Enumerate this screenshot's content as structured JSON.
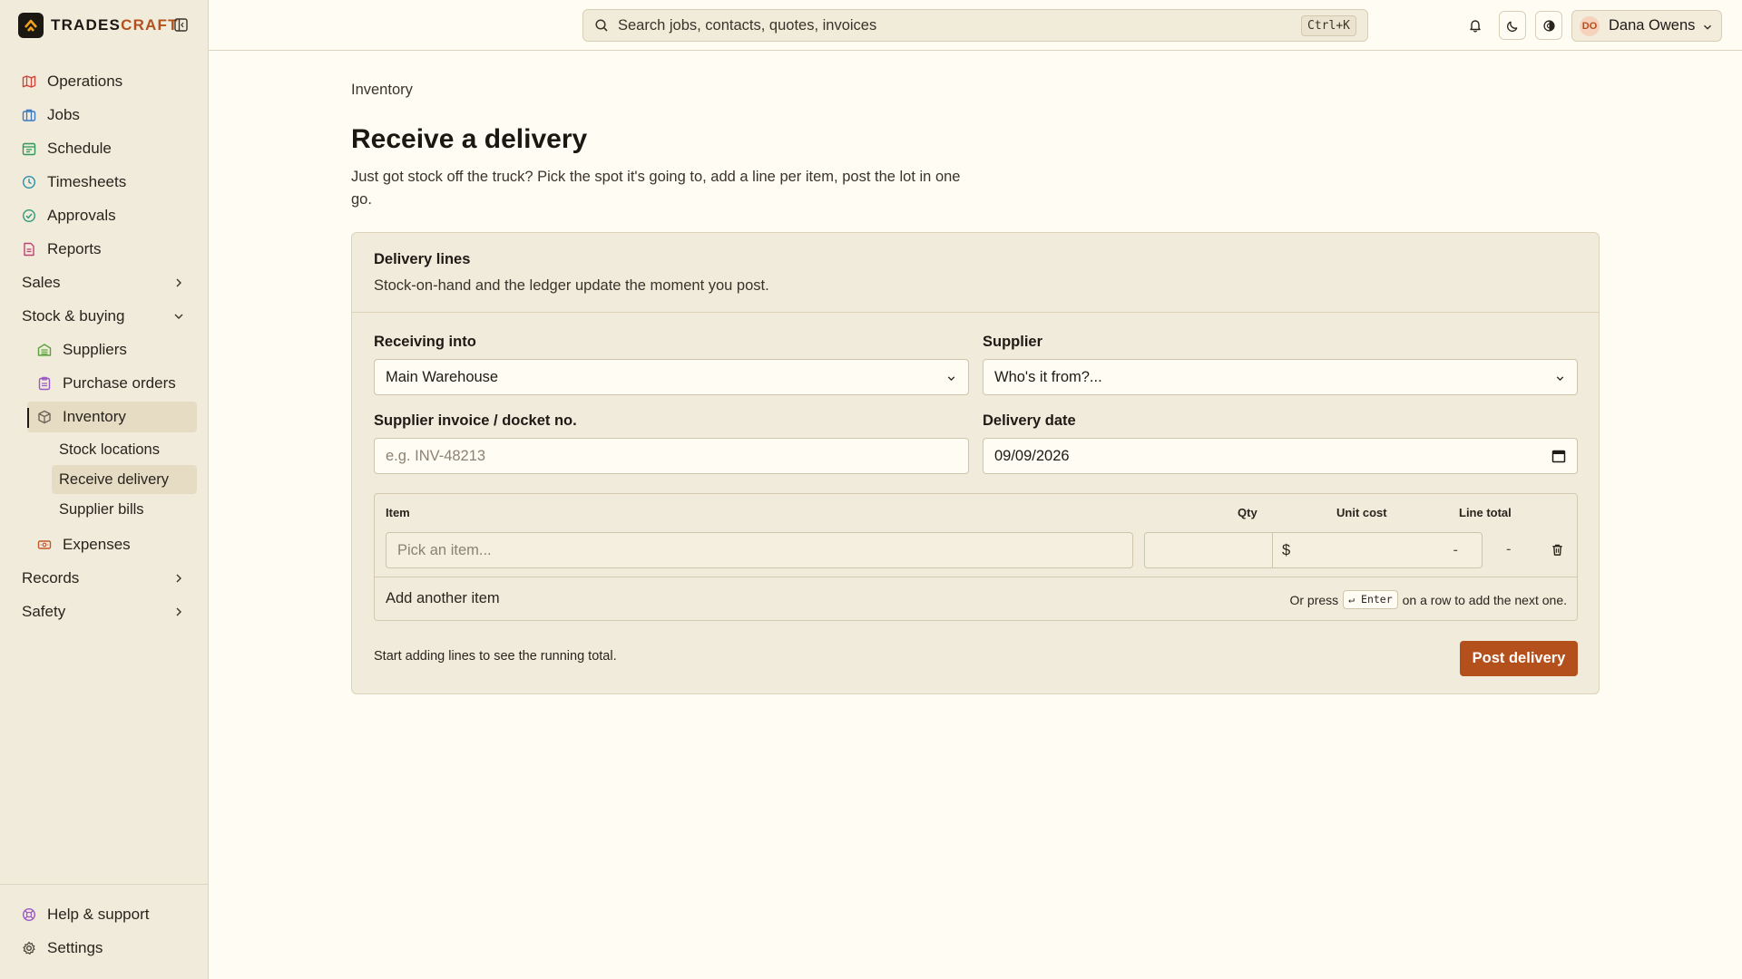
{
  "brand": {
    "name_part1": "TRADES",
    "name_part2": "CRAFT"
  },
  "search": {
    "placeholder": "Search jobs, contacts, quotes, invoices",
    "shortcut": "Ctrl+K"
  },
  "user": {
    "initials": "DO",
    "name": "Dana Owens"
  },
  "sidebar": {
    "items": [
      {
        "label": "Operations",
        "icon": "map-icon",
        "color": "#d2453c"
      },
      {
        "label": "Jobs",
        "icon": "briefcase-icon",
        "color": "#3b78c4"
      },
      {
        "label": "Schedule",
        "icon": "calendar-icon",
        "color": "#2e9a59"
      },
      {
        "label": "Timesheets",
        "icon": "clock-icon",
        "color": "#2a8fa8"
      },
      {
        "label": "Approvals",
        "icon": "check-circle-icon",
        "color": "#2e9a7a"
      },
      {
        "label": "Reports",
        "icon": "report-icon",
        "color": "#c2427a"
      }
    ],
    "groups": {
      "sales": "Sales",
      "stock": "Stock & buying",
      "records": "Records",
      "safety": "Safety"
    },
    "stock_items": {
      "suppliers": "Suppliers",
      "purchase_orders": "Purchase orders",
      "inventory": "Inventory",
      "expenses": "Expenses"
    },
    "inventory_sub": {
      "stock_locations": "Stock locations",
      "receive_delivery": "Receive delivery",
      "supplier_bills": "Supplier bills"
    },
    "bottom": {
      "help": "Help & support",
      "settings": "Settings"
    }
  },
  "main": {
    "breadcrumb": "Inventory",
    "title": "Receive a delivery",
    "description": "Just got stock off the truck? Pick the spot it's going to, add a line per item, post the lot in one go."
  },
  "card": {
    "title": "Delivery lines",
    "subtitle": "Stock-on-hand and the ledger update the moment you post.",
    "receiving_label": "Receiving into",
    "receiving_value": "Main Warehouse",
    "supplier_label": "Supplier",
    "supplier_placeholder": "Who's it from?...",
    "invoice_label": "Supplier invoice / docket no.",
    "invoice_placeholder": "e.g. INV-48213",
    "date_label": "Delivery date",
    "date_value": "09/09/2026",
    "columns": {
      "item": "Item",
      "qty": "Qty",
      "unit_cost": "Unit cost",
      "line_total": "Line total"
    },
    "line": {
      "item_placeholder": "Pick an item...",
      "currency": "$",
      "unit_cost_value": "-",
      "line_total_value": "-"
    },
    "add_item": "Add another item",
    "hint_pre": "Or press",
    "hint_key": "↵ Enter",
    "hint_post": "on a row to add the next one.",
    "footer_note": "Start adding lines to see the running total.",
    "post_button": "Post delivery"
  },
  "colors": {
    "accent": "#b4501c",
    "sidebar_bg": "#f1ebdb",
    "page_bg": "#fffcf3"
  }
}
